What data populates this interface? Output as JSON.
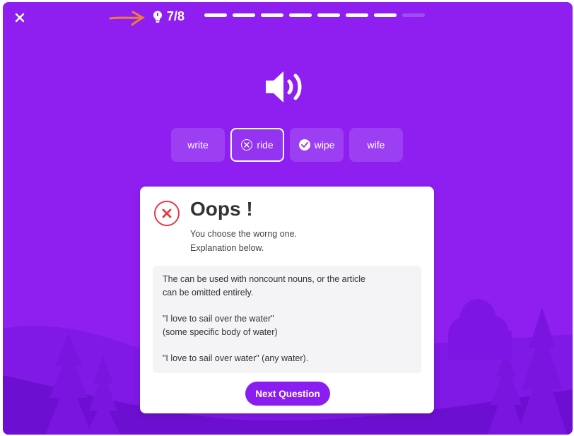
{
  "header": {
    "close_icon": "close-icon",
    "hint_icon": "lightbulb-icon",
    "hint_count": "7/8",
    "progress": {
      "completed": 7,
      "total": 8
    }
  },
  "audio": {
    "icon": "speaker-icon"
  },
  "options": [
    {
      "label": "write",
      "state": "neutral"
    },
    {
      "label": "ride",
      "state": "wrong",
      "icon": "x-circle-icon"
    },
    {
      "label": "wipe",
      "state": "correct",
      "icon": "check-circle-icon"
    },
    {
      "label": "wife",
      "state": "neutral"
    }
  ],
  "feedback": {
    "icon": "error-x-icon",
    "title": "Oops !",
    "subtitle_lines": [
      "You choose the worng one.",
      "Explanation below."
    ],
    "explanation": {
      "para1": [
        "The can be used with noncount nouns, or the article",
        "can be omitted entirely."
      ],
      "para2": [
        "\"I love to sail over the water\"",
        "(some specific body of water)"
      ],
      "para3": [
        "\"I love to sail over water\" (any water)."
      ]
    },
    "next_button": "Next Question"
  },
  "colors": {
    "background": "#8f1ff0",
    "option_bg": "#9c3ff2",
    "error": "#e53945",
    "button": "#8a1ef0",
    "annotation_arrow": "#f07b3a"
  }
}
